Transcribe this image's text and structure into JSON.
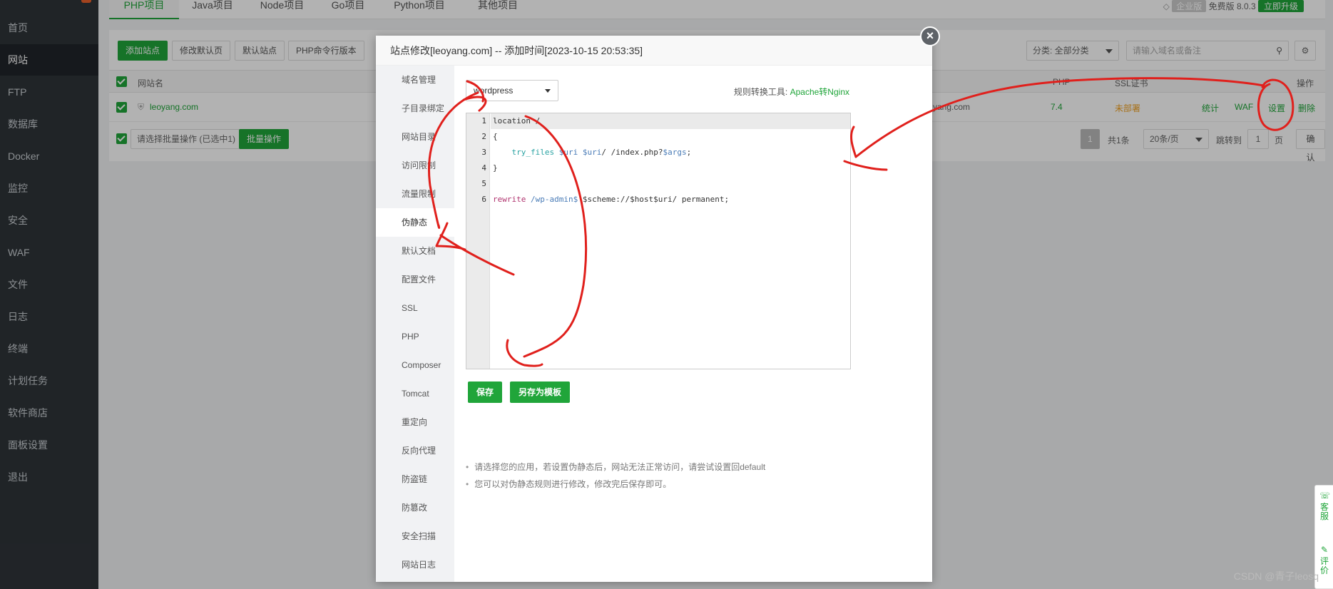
{
  "sidebar": {
    "items": [
      {
        "label": "首页"
      },
      {
        "label": "网站",
        "active": true
      },
      {
        "label": "FTP"
      },
      {
        "label": "数据库"
      },
      {
        "label": "Docker"
      },
      {
        "label": "监控"
      },
      {
        "label": "安全"
      },
      {
        "label": "WAF"
      },
      {
        "label": "文件"
      },
      {
        "label": "日志"
      },
      {
        "label": "终端"
      },
      {
        "label": "计划任务"
      },
      {
        "label": "软件商店"
      },
      {
        "label": "面板设置"
      },
      {
        "label": "退出"
      }
    ]
  },
  "top_tabs": [
    "PHP项目",
    "Java项目",
    "Node项目",
    "Go项目",
    "Python项目",
    "其他项目"
  ],
  "version": {
    "edition": "企业版",
    "free": "免费版",
    "number": "8.0.3",
    "upgrade": "立即升级"
  },
  "toolbar": {
    "add_site": "添加站点",
    "edit_default_page": "修改默认页",
    "default_site": "默认站点",
    "php_cli_version": "PHP命令行版本",
    "category": "分类: 全部分类",
    "search_placeholder": "请输入域名或备注"
  },
  "table": {
    "columns": {
      "site_name": "网站名",
      "php": "PHP",
      "ssl": "SSL证书",
      "actions": "操作"
    },
    "row": {
      "site": "leoyang.com",
      "domain_tail": "yang.com",
      "php": "7.4",
      "ssl": "未部署",
      "stats": "统计",
      "waf": "WAF",
      "settings": "设置",
      "delete": "删除"
    }
  },
  "footer": {
    "batch_select": "请选择批量操作 (已选中1)",
    "batch_btn": "批量操作",
    "page": "1",
    "total": "共1条",
    "per_page": "20条/页",
    "jump_to": "跳转到",
    "jump_page": "1",
    "page_unit": "页",
    "confirm": "确认"
  },
  "modal": {
    "title": "站点修改[leoyang.com] -- 添加时间[2023-10-15 20:53:35]",
    "close": "×",
    "nav": [
      "域名管理",
      "子目录绑定",
      "网站目录",
      "访问限制",
      "流量限制",
      "伪静态",
      "默认文档",
      "配置文件",
      "SSL",
      "PHP",
      "Composer",
      "Tomcat",
      "重定向",
      "反向代理",
      "防盗链",
      "防篡改",
      "安全扫描",
      "网站日志"
    ],
    "active_nav": "伪静态",
    "rule_select": "wordpress",
    "rule_tool_label": "规则转换工具:",
    "rule_tool_link": "Apache转Nginx",
    "editor_lines": [
      "1",
      "2",
      "3",
      "4",
      "5",
      "6"
    ],
    "code": {
      "l1": "location /",
      "l2": "{",
      "l3_a": "try_files",
      "l3_b": "$uri",
      "l3_c": "$uri",
      "l3_d": "/ /index.php?",
      "l3_e": "$args",
      "l3_f": ";",
      "l4": "}",
      "l6_a": "rewrite",
      "l6_b": "/wp-admin$",
      "l6_c": " $scheme://$host$uri/ permanent;"
    },
    "save": "保存",
    "save_template": "另存为模板",
    "tips": [
      "请选择您的应用，若设置伪静态后，网站无法正常访问，请尝试设置回default",
      "您可以对伪静态规则进行修改，修改完后保存即可。"
    ]
  },
  "float_widget": {
    "service": "客服",
    "review": "评价"
  },
  "watermark": "CSDN @青子leosq",
  "colors": {
    "accent": "#20a53a",
    "annotation": "#e0201c",
    "sidebar": "#2f3439"
  }
}
